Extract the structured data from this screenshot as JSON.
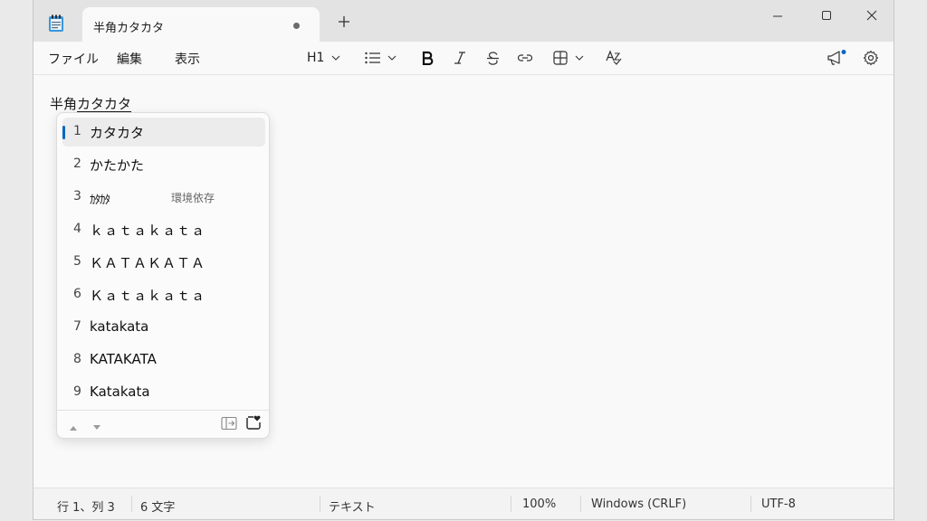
{
  "tab": {
    "title": "半角カタカタ"
  },
  "menu": {
    "file": "ファイル",
    "edit": "編集",
    "view": "表示"
  },
  "toolbar": {
    "heading": "H1"
  },
  "editor": {
    "prefix": "半角",
    "composition": "カタカタ"
  },
  "ime": {
    "candidates": [
      {
        "num": "1",
        "text": "カタカタ",
        "note": ""
      },
      {
        "num": "2",
        "text": "かたかた",
        "note": ""
      },
      {
        "num": "3",
        "text": "ｶﾀｶﾀ",
        "note": "環境依存"
      },
      {
        "num": "4",
        "text": "ｋａｔａｋａｔａ",
        "note": ""
      },
      {
        "num": "5",
        "text": "ＫＡＴＡＫＡＴＡ",
        "note": ""
      },
      {
        "num": "6",
        "text": "Ｋａｔａｋａｔａ",
        "note": ""
      },
      {
        "num": "7",
        "text": "katakata",
        "note": ""
      },
      {
        "num": "8",
        "text": "KATAKATA",
        "note": ""
      },
      {
        "num": "9",
        "text": "Katakata",
        "note": ""
      }
    ]
  },
  "status": {
    "position": "行 1、列 3",
    "chars": "6 文字",
    "format": "テキスト",
    "zoom": "100%",
    "line_ending": "Windows (CRLF)",
    "encoding": "UTF-8"
  },
  "colors": {
    "accent": "#0067c0",
    "notification_dot": "#0067c0"
  }
}
